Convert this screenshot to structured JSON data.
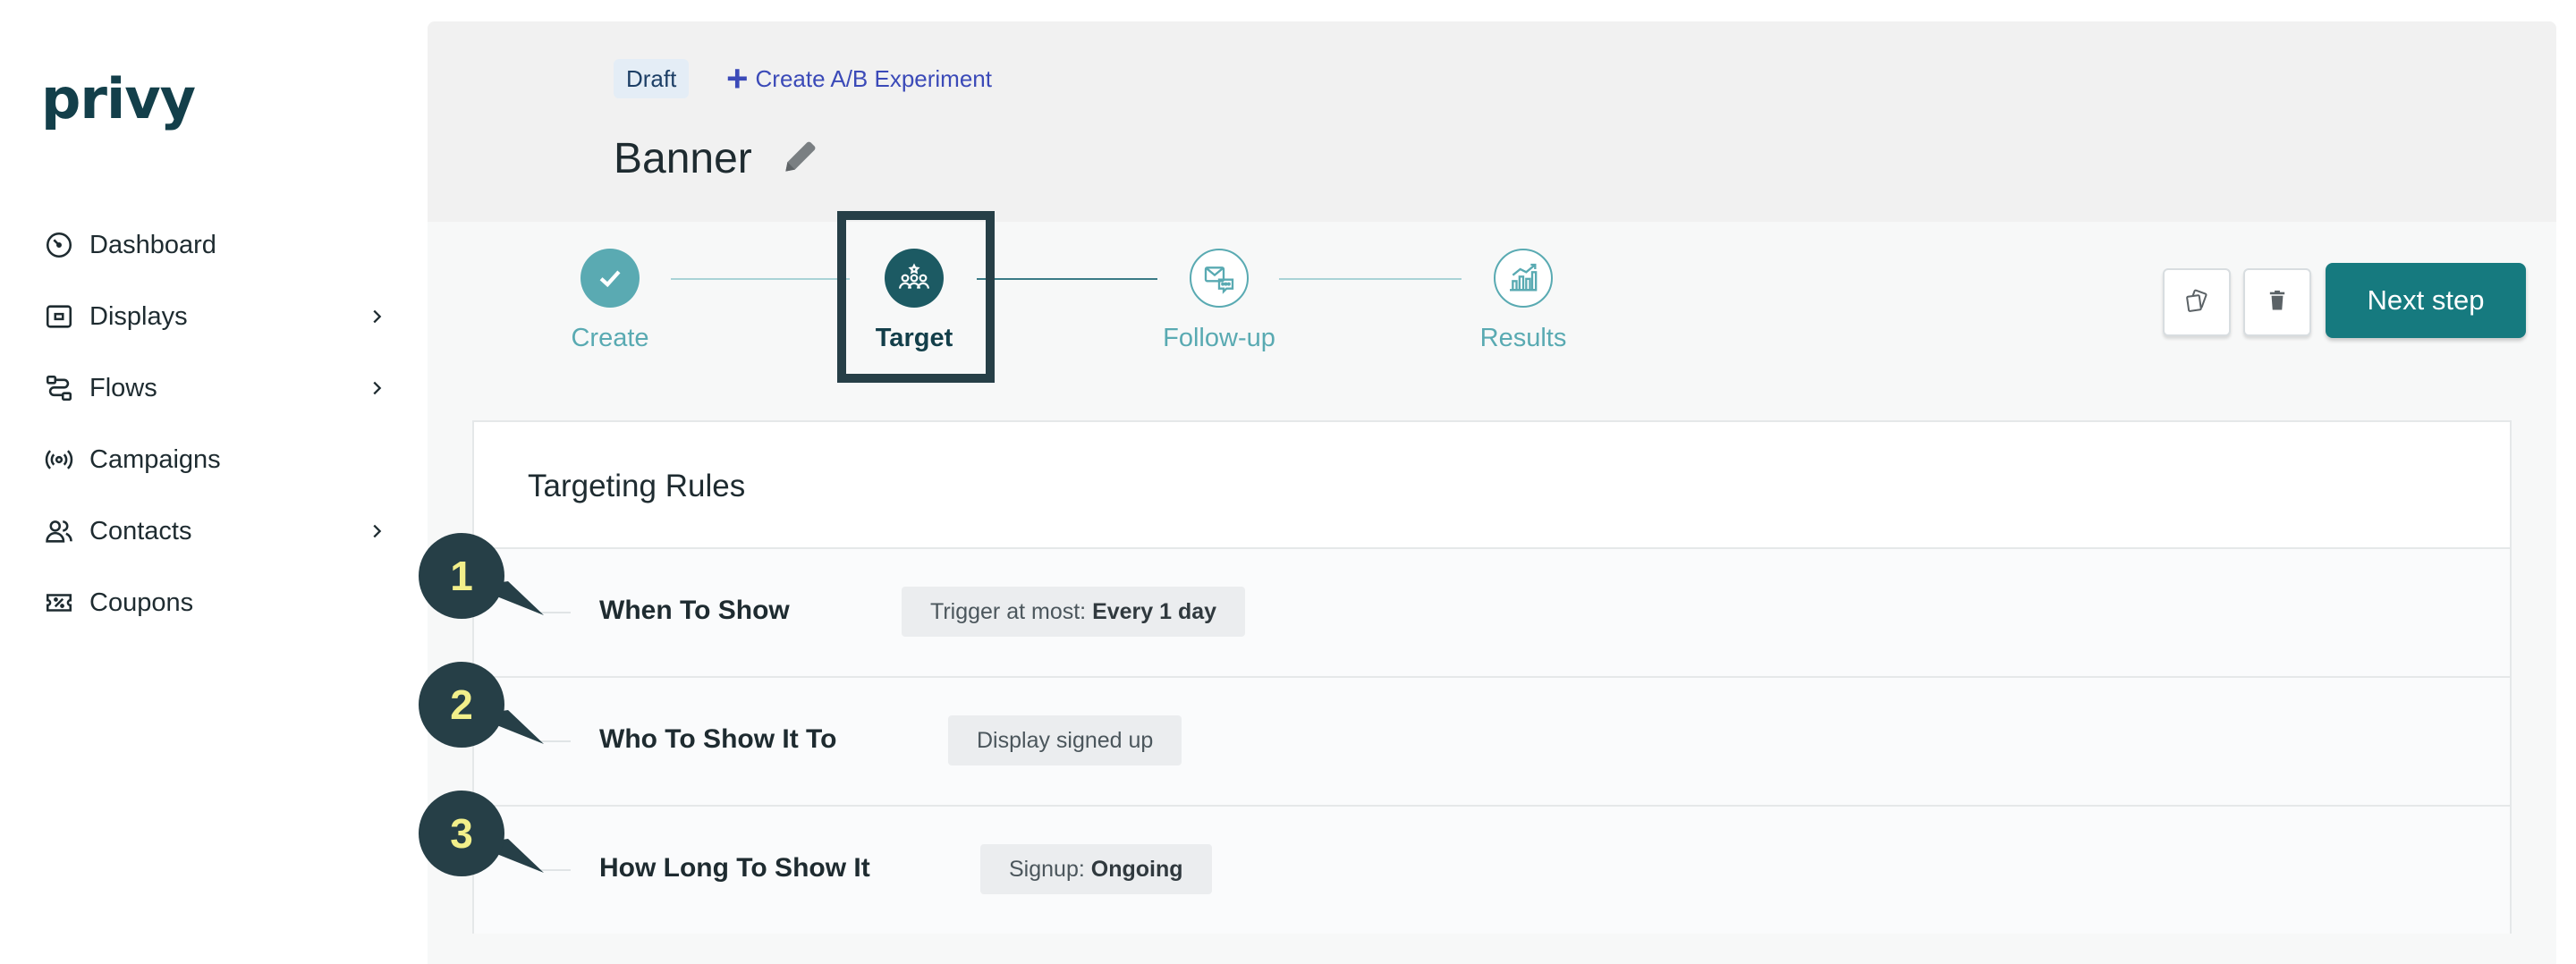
{
  "brand": {
    "logo_text": "privy"
  },
  "sidebar": {
    "items": [
      {
        "label": "Dashboard",
        "icon": "speedometer-icon",
        "has_children": false
      },
      {
        "label": "Displays",
        "icon": "display-icon",
        "has_children": true
      },
      {
        "label": "Flows",
        "icon": "flow-icon",
        "has_children": true
      },
      {
        "label": "Campaigns",
        "icon": "broadcast-icon",
        "has_children": false
      },
      {
        "label": "Contacts",
        "icon": "people-icon",
        "has_children": true
      },
      {
        "label": "Coupons",
        "icon": "coupon-icon",
        "has_children": false
      }
    ]
  },
  "header": {
    "status_badge": "Draft",
    "ab_link": "Create A/B Experiment",
    "title": "Banner"
  },
  "stepper": {
    "steps": [
      {
        "label": "Create",
        "state": "complete"
      },
      {
        "label": "Target",
        "state": "active"
      },
      {
        "label": "Follow-up",
        "state": "pending"
      },
      {
        "label": "Results",
        "state": "pending"
      }
    ]
  },
  "toolbar": {
    "next_label": "Next step",
    "duplicate_icon": "copy-icon",
    "delete_icon": "trash-icon"
  },
  "targeting": {
    "title": "Targeting Rules",
    "rules": [
      {
        "number": "1",
        "name": "When To Show",
        "chip_prefix": "Trigger at most: ",
        "chip_value": "Every 1 day"
      },
      {
        "number": "2",
        "name": "Who To Show It To",
        "chip_prefix": "Display signed up",
        "chip_value": ""
      },
      {
        "number": "3",
        "name": "How Long To Show It",
        "chip_prefix": "Signup: ",
        "chip_value": "Ongoing"
      }
    ]
  },
  "colors": {
    "primary": "#167a7f",
    "brand_dark": "#133f4a",
    "step_light": "#59aab2",
    "callout_bg": "#263f47",
    "callout_text": "#f2ef8a"
  }
}
